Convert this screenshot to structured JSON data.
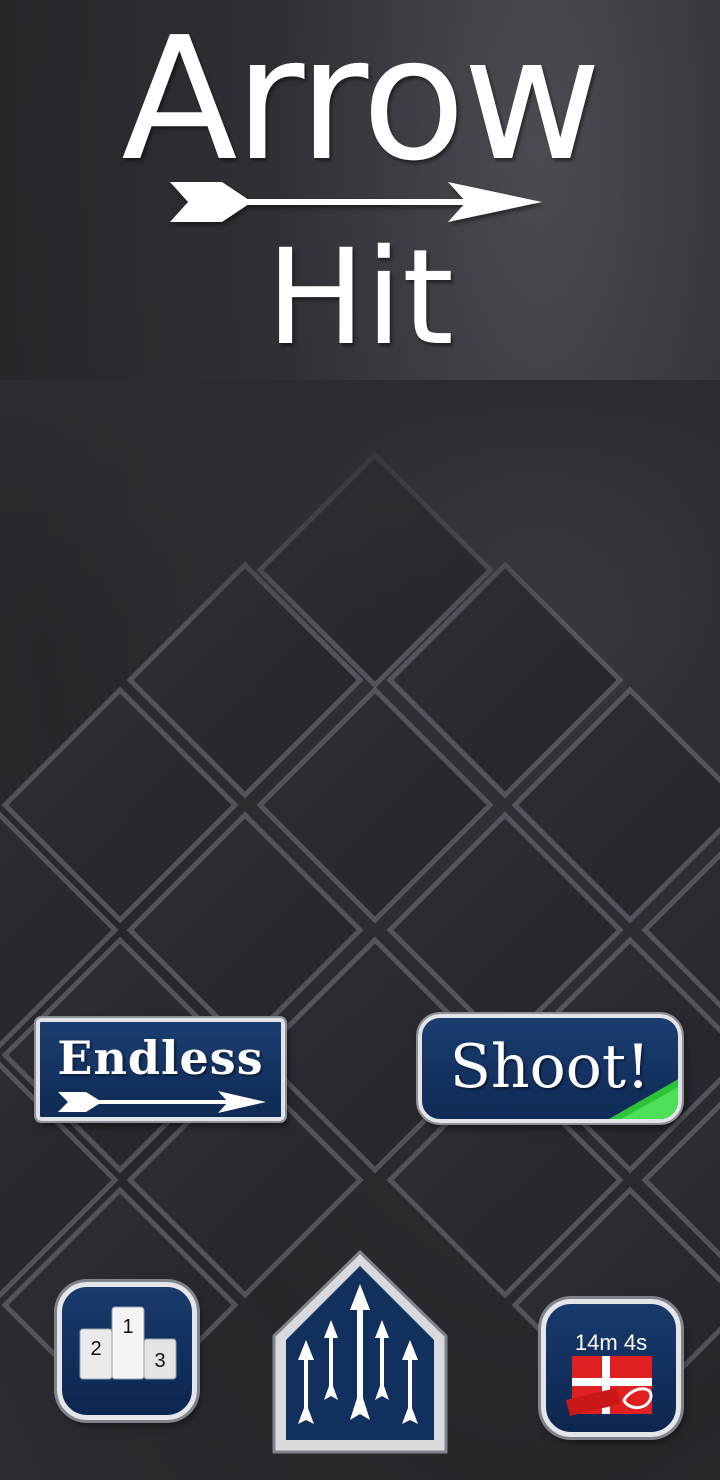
{
  "title": {
    "line1": "Arrow",
    "line2": "Hit"
  },
  "buttons": {
    "endless": {
      "label": "Endless"
    },
    "shoot": {
      "label": "Shoot!",
      "progress": 0.3
    },
    "leaderboard": {
      "icon": "podium-icon",
      "places": [
        "1",
        "2",
        "3"
      ]
    },
    "arrows": {
      "icon": "arrows-icon"
    },
    "gift": {
      "icon": "gift-icon",
      "timer": "14m 4s"
    }
  },
  "colors": {
    "button_fill": "#0f2a55",
    "button_border": "#e2e4e8",
    "progress_green": "#2ec43a",
    "gift_red": "#e02020"
  }
}
